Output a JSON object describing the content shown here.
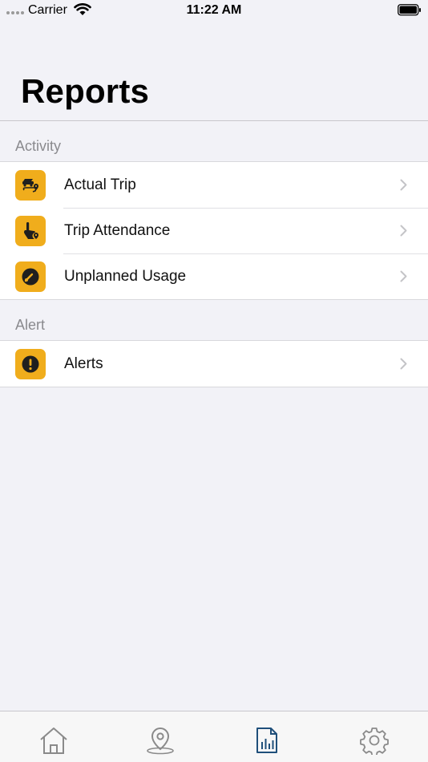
{
  "status_bar": {
    "carrier": "Carrier",
    "time": "11:22 AM"
  },
  "page": {
    "title": "Reports"
  },
  "sections": [
    {
      "header": "Activity",
      "items": [
        {
          "label": "Actual Trip",
          "icon": "route-map-icon"
        },
        {
          "label": "Trip Attendance",
          "icon": "tap-location-icon"
        },
        {
          "label": "Unplanned Usage",
          "icon": "speedometer-icon"
        }
      ]
    },
    {
      "header": "Alert",
      "items": [
        {
          "label": "Alerts",
          "icon": "exclamation-icon"
        }
      ]
    }
  ],
  "tab_bar": {
    "tabs": [
      {
        "name": "home",
        "icon": "home-icon"
      },
      {
        "name": "map",
        "icon": "location-pin-icon"
      },
      {
        "name": "reports",
        "icon": "report-chart-icon",
        "active": true
      },
      {
        "name": "settings",
        "icon": "gear-icon"
      }
    ]
  },
  "colors": {
    "accent": "#f0ad1c",
    "active_tab": "#1f4f7a",
    "inactive_tab": "#8a8a8a",
    "background": "#f2f2f7"
  }
}
